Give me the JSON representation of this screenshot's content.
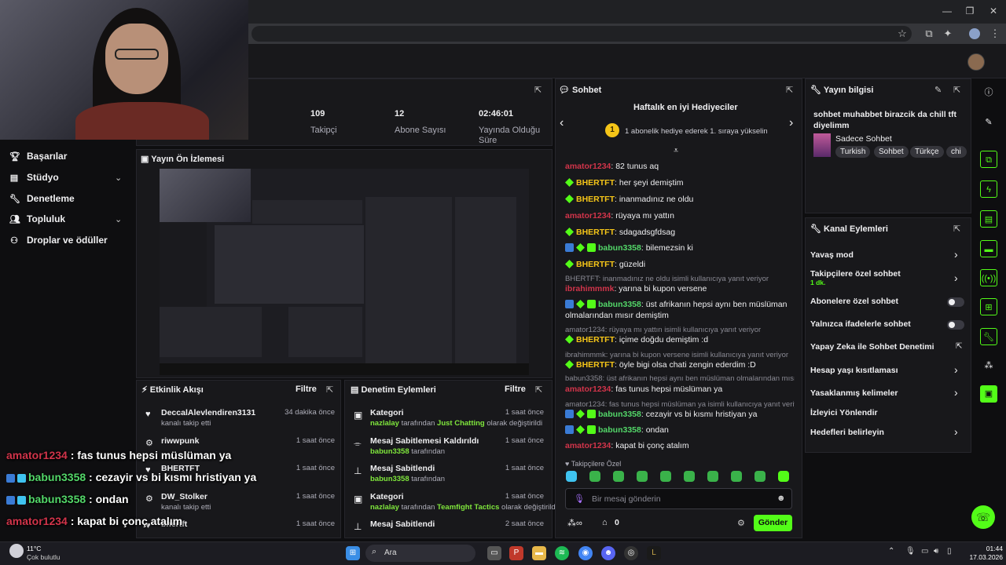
{
  "stats": [
    {
      "value": "109",
      "label": "Takipçi"
    },
    {
      "value": "12",
      "label": "Abone Sayısı"
    },
    {
      "value": "02:46:01",
      "label": "Yayında Olduğu Süre"
    }
  ],
  "sidebar": {
    "items": [
      {
        "label": "Başarılar",
        "icon": "trophy-icon"
      },
      {
        "label": "Stüdyo",
        "icon": "studio-icon"
      },
      {
        "label": "Denetleme",
        "icon": "wrench-icon"
      },
      {
        "label": "Topluluk",
        "icon": "community-icon"
      },
      {
        "label": "Droplar ve ödüller",
        "icon": "drops-icon"
      }
    ]
  },
  "preview": {
    "title": "Yayın Ön İzlemesi"
  },
  "activity": {
    "title": "Etkinlik Akışı",
    "filter": "Filtre",
    "items": [
      {
        "name": "DeccalAlevlendiren3131",
        "sub": "kanalı takip etti",
        "time": "34 dakika önce"
      },
      {
        "name": "riwwpunk",
        "sub": "",
        "time": "1 saat önce"
      },
      {
        "name": "BHERTFT",
        "sub": "",
        "time": "1 saat önce"
      },
      {
        "name": "DW_Stolker",
        "sub": "kanalı takip etti",
        "time": "1 saat önce"
      },
      {
        "name": "bhertft",
        "sub": "",
        "time": "1 saat önce"
      }
    ]
  },
  "moderation": {
    "title": "Denetim Eylemleri",
    "filter": "Filtre",
    "items": [
      {
        "title": "Kategori",
        "user": "nazlalay",
        "mid": " tarafından ",
        "value": "Just Chatting",
        "tail": " olarak değiştirildi",
        "time": "1 saat önce"
      },
      {
        "title": "Mesaj Sabitlemesi Kaldırıldı",
        "user": "babun3358",
        "mid": " tarafından",
        "value": "",
        "tail": "",
        "time": "1 saat önce"
      },
      {
        "title": "Mesaj Sabitlendi",
        "user": "babun3358",
        "mid": " tarafından",
        "value": "",
        "tail": "",
        "time": "1 saat önce"
      },
      {
        "title": "Kategori",
        "user": "nazlalay",
        "mid": " tarafından ",
        "value": "Teamfight Tactics",
        "tail": " olarak değiştirildi",
        "time": "1 saat önce"
      },
      {
        "title": "Mesaj Sabitlendi",
        "user": "",
        "mid": "",
        "value": "",
        "tail": "",
        "time": "2 saat önce"
      }
    ]
  },
  "chat": {
    "title": "Sohbet",
    "leaderboard_title": "Haftalık en iyi Hediyeciler",
    "leaderboard_rank": "1",
    "leaderboard_text": "1 abonelik hediye ederek 1. sıraya yükselin",
    "followers_only_label": "Takipçilere Özel",
    "input_placeholder": "Bir mesaj gönderin",
    "points": "0",
    "send_label": "Gönder",
    "messages": [
      {
        "user": "amator1234",
        "text": ": 82 tunus aq"
      },
      {
        "user": "BHERTFT",
        "text": ": her şeyi demiştim"
      },
      {
        "user": "BHERTFT",
        "text": ": inanmadınız ne oldu"
      },
      {
        "user": "amator1234",
        "text": ": rüyaya mı yattın"
      },
      {
        "user": "BHERTFT",
        "text": ": sdagadsgfdsag"
      },
      {
        "user": "babun3358",
        "text": ": bilemezsin ki"
      },
      {
        "user": "BHERTFT",
        "text": ": güzeldi"
      },
      {
        "reply": "BHERTFT: inanmadınız ne oldu isimli kullanıcıya yanıt veriyor"
      },
      {
        "user": "ibrahimmmk",
        "text": ": yarına bi kupon versene"
      },
      {
        "user": "babun3358",
        "text": ": üst afrikanın hepsi aynı ben müslüman olmalarından mısır demiştim"
      },
      {
        "reply": "amator1234: rüyaya mı yattın isimli kullanıcıya yanıt veriyor"
      },
      {
        "user": "BHERTFT",
        "text": ": içime doğdu demiştim :d"
      },
      {
        "reply": "ibrahimmmk: yarına bi kupon versene isimli kullanıcıya yanıt veriyor"
      },
      {
        "user": "BHERTFT",
        "text": ": öyle bigi olsa chati zengin ederdim :D"
      },
      {
        "reply": "babun3358: üst afrikanın hepsi aynı ben müslüman olmalarından mısır..."
      },
      {
        "user": "amator1234",
        "text": ": fas tunus hepsi müslüman ya"
      },
      {
        "reply": "amator1234: fas tunus hepsi müslüman ya isimli kullanıcıya yanıt veriyor"
      },
      {
        "user": "babun3358",
        "text": ": cezayir vs bi kısmı hristiyan ya"
      },
      {
        "user": "babun3358",
        "text": ": ondan"
      },
      {
        "user": "amator1234",
        "text": ": kapat bi çonç atalım"
      }
    ]
  },
  "overlay": [
    {
      "user": "amator1234",
      "text": " : fas tunus hepsi müslüman ya"
    },
    {
      "user": "babun3358",
      "text": " : cezayir vs bi kısmı hristiyan ya"
    },
    {
      "user": "babun3358",
      "text": " : ondan"
    },
    {
      "user": "amator1234",
      "text": " : kapat bi çonç atalım"
    }
  ],
  "stream_info": {
    "title_label": "Yayın bilgisi",
    "stream_title": "sohbet muhabbet birazcik da chill tft diyelimm",
    "category": "Sadece Sohbet",
    "tags": [
      "Turkish",
      "Sohbet",
      "Türkçe",
      "chi"
    ]
  },
  "channel_actions": {
    "title": "Kanal Eylemleri",
    "items": [
      {
        "label": "Yavaş mod",
        "control": "chevron"
      },
      {
        "label": "Takipçilere özel sohbet",
        "sub": "1 dk.",
        "control": "chevron"
      },
      {
        "label": "Abonelere özel sohbet",
        "control": "toggle"
      },
      {
        "label": "Yalnızca ifadelerle sohbet",
        "control": "toggle"
      },
      {
        "label": "Yapay Zeka ile Sohbet Denetimi",
        "control": "external"
      },
      {
        "label": "Hesap yaşı kısıtlaması",
        "control": "chevron"
      },
      {
        "label": "Yasaklanmış kelimeler",
        "control": "chevron"
      },
      {
        "label": "İzleyici Yönlendir",
        "control": "none"
      },
      {
        "label": "Hedefleri belirleyin",
        "control": "chevron"
      }
    ]
  },
  "taskbar": {
    "temperature": "11°C",
    "weather": "Çok bulutlu",
    "search_placeholder": "Ara",
    "time": "01:44",
    "date": "17.03.2026"
  }
}
